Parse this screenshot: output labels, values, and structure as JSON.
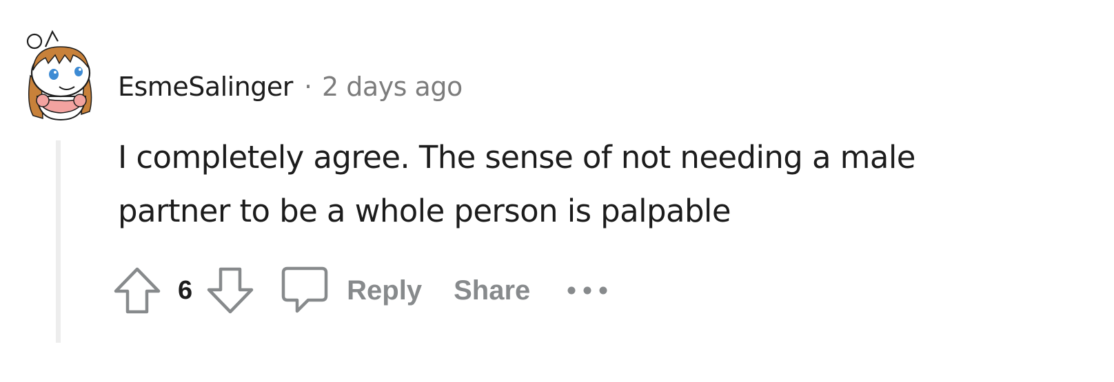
{
  "comment": {
    "author": "EsmeSalinger",
    "separator": "·",
    "timestamp": "2 days ago",
    "body": "I completely agree. The sense of not needing a male partner to be a whole person is palpable",
    "votes": "6"
  },
  "actions": {
    "reply_label": "Reply",
    "share_label": "Share"
  },
  "icons": {
    "avatar": "snoo-avatar",
    "upvote": "upvote-arrow-icon",
    "downvote": "downvote-arrow-icon",
    "reply": "speech-bubble-icon",
    "more": "more-options-icon"
  },
  "colors": {
    "text": "#1c1c1c",
    "muted": "#7c7c7c",
    "icon": "#878a8c",
    "thread_line": "#ededed"
  }
}
